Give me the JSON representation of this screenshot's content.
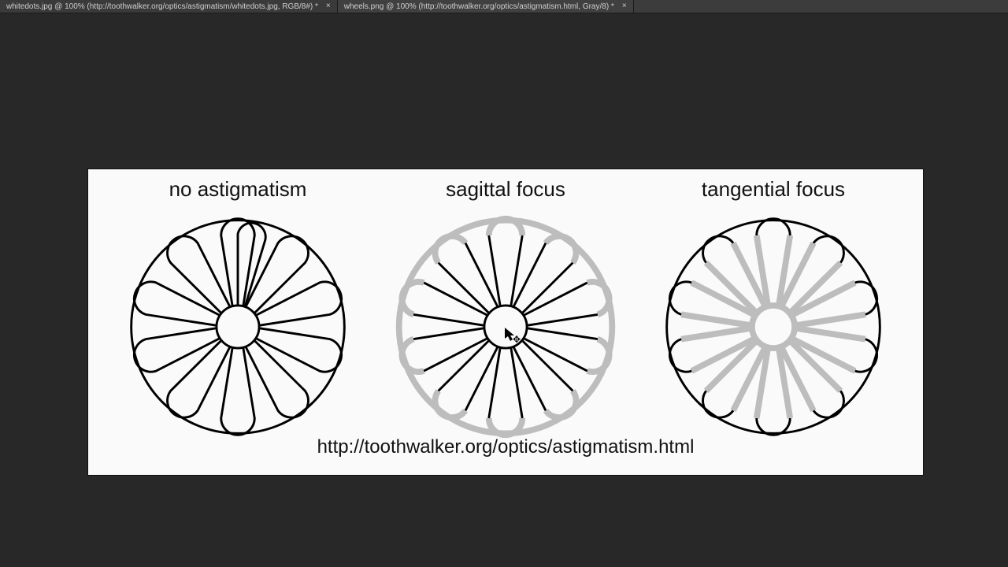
{
  "tabs": [
    {
      "label": "whitedots.jpg @ 100% (http://toothwalker.org/optics/astigmatism/whitedots.jpg, RGB/8#) *",
      "active": false
    },
    {
      "label": "wheels.png @ 100% (http://toothwalker.org/optics/astigmatism.html, Gray/8) *",
      "active": true
    }
  ],
  "image": {
    "titles": {
      "no_astigmatism": "no astigmatism",
      "sagittal": "sagittal focus",
      "tangential": "tangential focus"
    },
    "caption": "http://toothwalker.org/optics/astigmatism.html"
  }
}
